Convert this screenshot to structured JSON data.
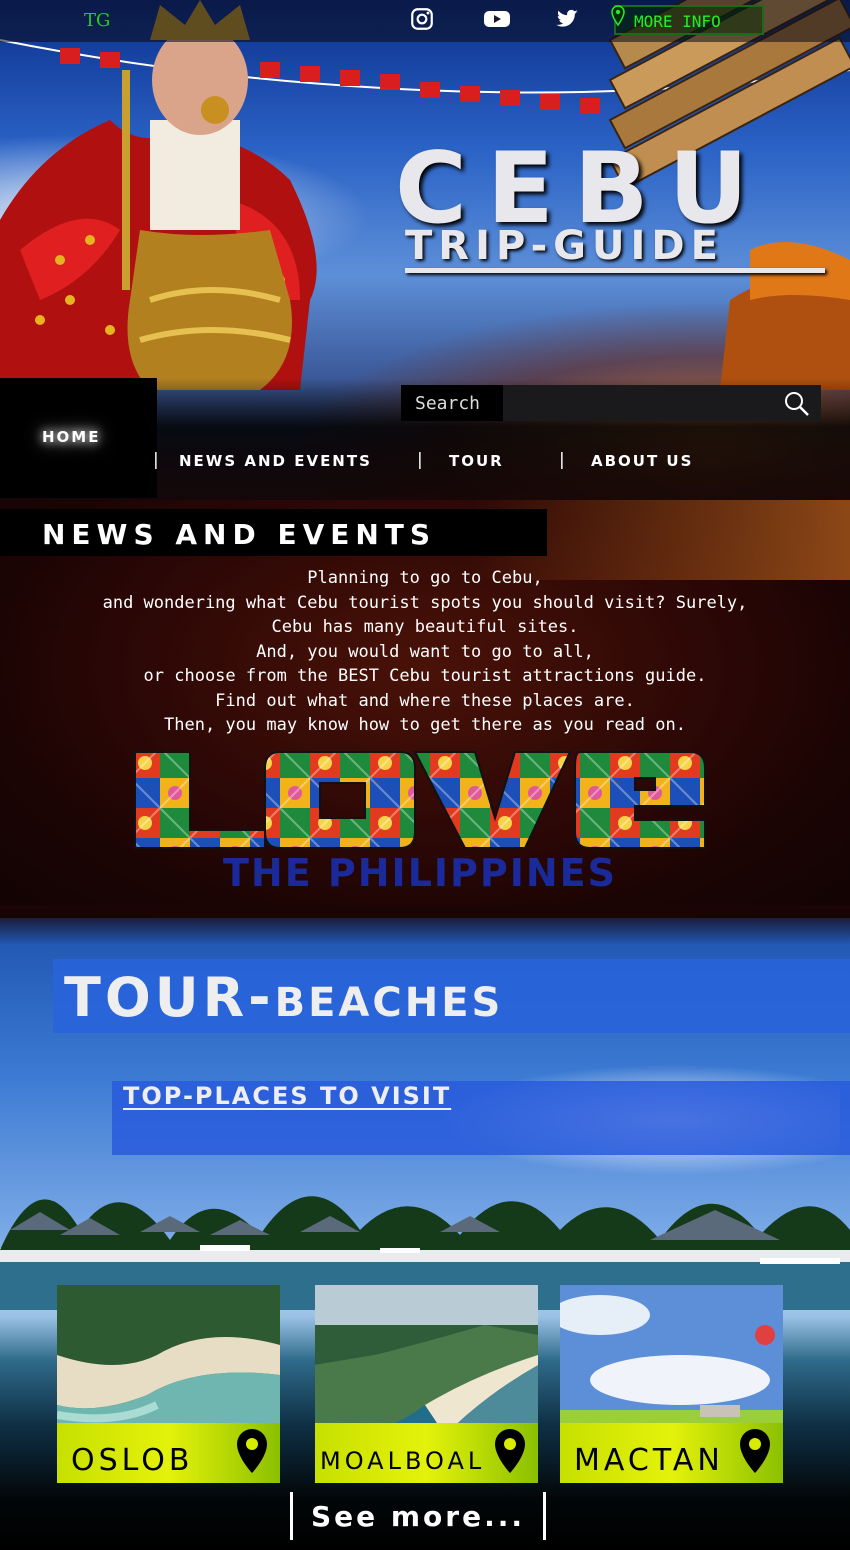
{
  "brand": {
    "tg": "TG",
    "title_line1": "CEBU",
    "title_line2": "TRIP-GUIDE"
  },
  "topbar": {
    "icons": [
      "instagram-icon",
      "youtube-icon",
      "twitter-icon"
    ],
    "more_info": "MORE INFO"
  },
  "search": {
    "label": "Search",
    "value": ""
  },
  "nav": {
    "home": "HOME",
    "items": [
      "NEWS AND EVENTS",
      "TOUR",
      "ABOUT US"
    ],
    "separator": "|"
  },
  "news": {
    "title": "NEWS AND EVENTS",
    "lines": [
      "Planning to go to Cebu,",
      "and wondering what Cebu tourist spots you should visit? Surely,",
      "Cebu has many beautiful sites.",
      "And, you would want to go to all,",
      "or choose from the BEST Cebu tourist attractions guide.",
      "Find out what and where these places are.",
      "Then, you may know how to get there as you read on."
    ],
    "banner_line1": "LOVE",
    "banner_line2": "THE PHILIPPINES"
  },
  "tour": {
    "title_big": "TOUR-",
    "title_small": "BEACHES",
    "subtitle": "TOP-PLACES TO VISIT",
    "cards": [
      {
        "label": "OSLOB"
      },
      {
        "label": "MOALBOAL"
      },
      {
        "label": "MACTAN"
      }
    ],
    "see_more": "See more..."
  },
  "colors": {
    "tg_green": "#22cc22",
    "more_info_green": "#22ee22",
    "card_label_bg": "#d8ec00",
    "tour_box_blue": "#2864dc"
  }
}
